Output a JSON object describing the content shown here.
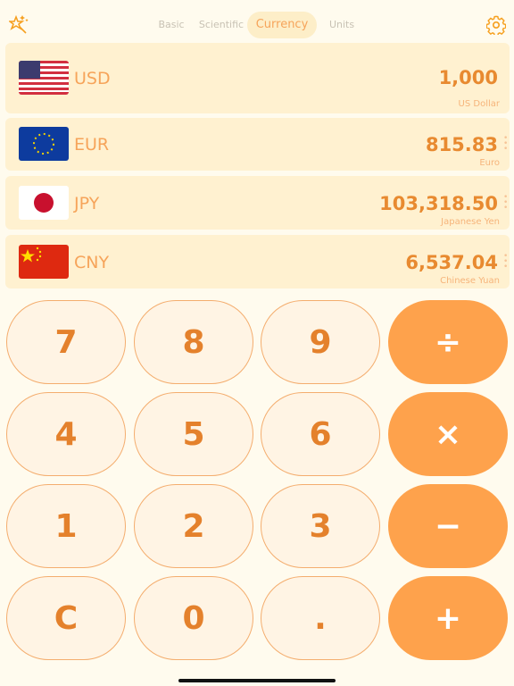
{
  "header": {
    "tabs": [
      "Basic",
      "Scientific",
      "Currency",
      "Units"
    ],
    "active_tab": "Currency"
  },
  "currencies": [
    {
      "code": "USD",
      "value": "1,000",
      "name": "US Dollar"
    },
    {
      "code": "EUR",
      "value": "815.83",
      "name": "Euro"
    },
    {
      "code": "JPY",
      "value": "103,318.50",
      "name": "Japanese Yen"
    },
    {
      "code": "CNY",
      "value": "6,537.04",
      "name": "Chinese Yuan"
    }
  ],
  "keypad": [
    [
      "7",
      "8",
      "9",
      "÷"
    ],
    [
      "4",
      "5",
      "6",
      "×"
    ],
    [
      "1",
      "2",
      "3",
      "−"
    ],
    [
      "C",
      "0",
      ".",
      "+"
    ]
  ],
  "colors": {
    "accent": "#fea24c",
    "background": "#fffbee",
    "row": "#fff1d0"
  }
}
